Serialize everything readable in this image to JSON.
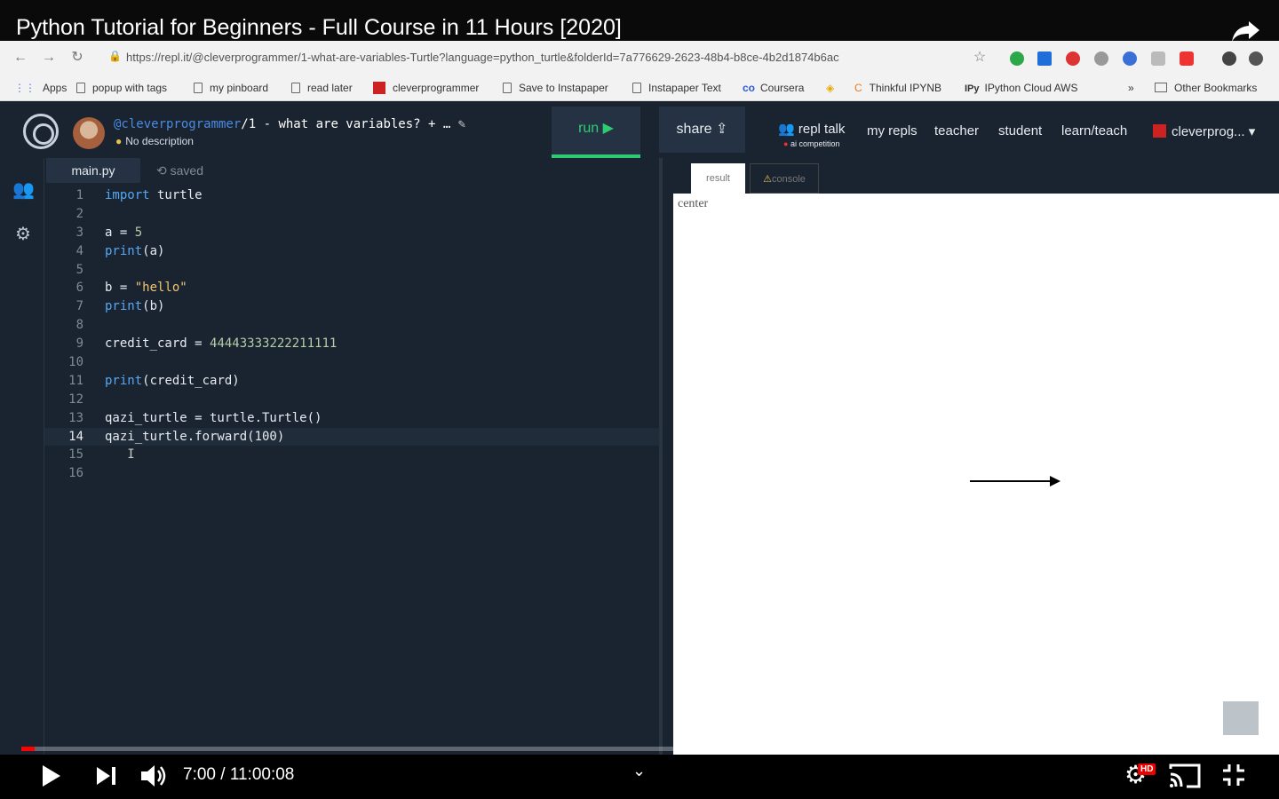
{
  "video": {
    "title": "Python Tutorial for Beginners - Full Course in 11 Hours [2020]",
    "time": "7:00 / 11:00:08",
    "progress_fraction": 0.0106
  },
  "browser": {
    "url": "https://repl.it/@cleverprogrammer/1-what-are-variables-Turtle?language=python_turtle&folderId=7a776629-2623-48b4-b8ce-4b2d1874b6ac",
    "bookmarks": [
      "Apps",
      "popup with tags",
      "my pinboard",
      "read later",
      "cleverprogrammer",
      "Save to Instapaper",
      "Instapaper Text",
      "Coursera",
      "Thinkful IPYNB",
      "IPython Cloud AWS"
    ],
    "bookmarks_overflow": "»",
    "other_bookmarks": "Other Bookmarks"
  },
  "repl": {
    "owner": "@cleverprogrammer",
    "name_rest": "/1 - what are variables? + …",
    "description": "No description",
    "run_label": "run ▶",
    "share_label": "share",
    "nav": {
      "repl_talk": "repl talk",
      "repl_talk_sub": "ai competition",
      "my_repls": "my repls",
      "teacher": "teacher",
      "student": "student",
      "learn_teach": "learn/teach",
      "user": "cleverprog..."
    }
  },
  "editor": {
    "file_tab": "main.py",
    "saved_label": "saved",
    "active_line": 14
  },
  "output": {
    "result_tab": "result",
    "console_tab": "console",
    "canvas_label": "center"
  },
  "colors": {
    "accent_green": "#2ecc71",
    "editor_bg": "#1a2330",
    "keyword_blue": "#56a8f5",
    "progress_red": "#ff0000"
  }
}
